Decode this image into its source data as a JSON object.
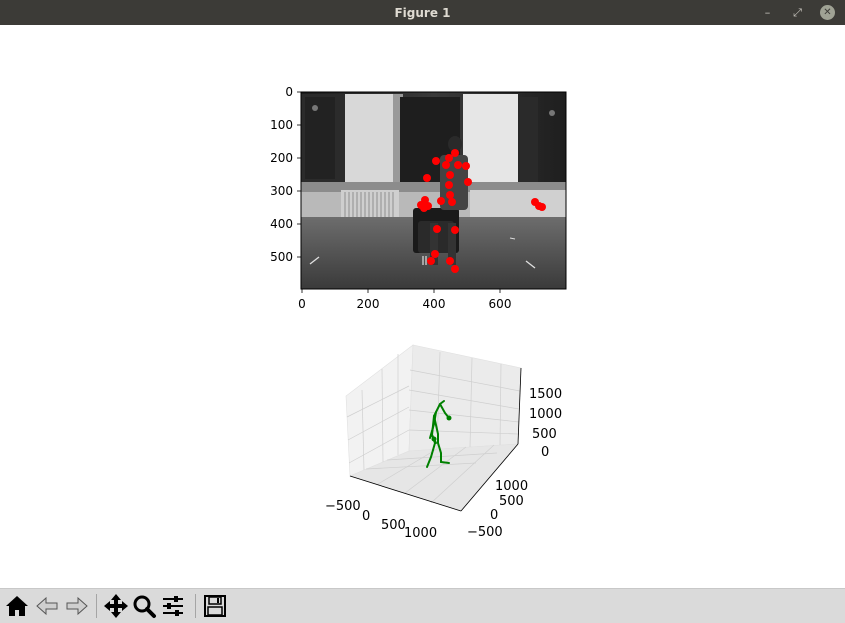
{
  "window": {
    "title": "Figure 1",
    "minimize_glyph": "–",
    "maximize_glyph": "⤢",
    "close_glyph": "✕"
  },
  "colors": {
    "titlebar": "#3c3b37",
    "keypoints": "#ff0000",
    "skeleton": "#008000",
    "toolbar": "#dadada"
  },
  "image_axes": {
    "x_ticks": [
      "0",
      "200",
      "400",
      "600"
    ],
    "y_ticks": [
      "0",
      "100",
      "200",
      "300",
      "400",
      "500"
    ]
  },
  "axes3d": {
    "x_ticks": [
      "−500",
      "0",
      "500",
      "1000"
    ],
    "y_ticks": [
      "1000",
      "500",
      "0",
      "−500"
    ],
    "z_ticks": [
      "0",
      "500",
      "1000",
      "1500"
    ]
  },
  "toolbar": {
    "buttons": [
      {
        "name": "home-button",
        "icon": "home-icon"
      },
      {
        "name": "back-button",
        "icon": "arrow-left-icon"
      },
      {
        "name": "forward-button",
        "icon": "arrow-right-icon"
      },
      {
        "name": "pan-button",
        "icon": "move-icon"
      },
      {
        "name": "zoom-button",
        "icon": "magnifier-icon"
      },
      {
        "name": "configure-subplots-button",
        "icon": "sliders-icon"
      },
      {
        "name": "save-button",
        "icon": "floppy-disk-icon"
      }
    ]
  }
}
